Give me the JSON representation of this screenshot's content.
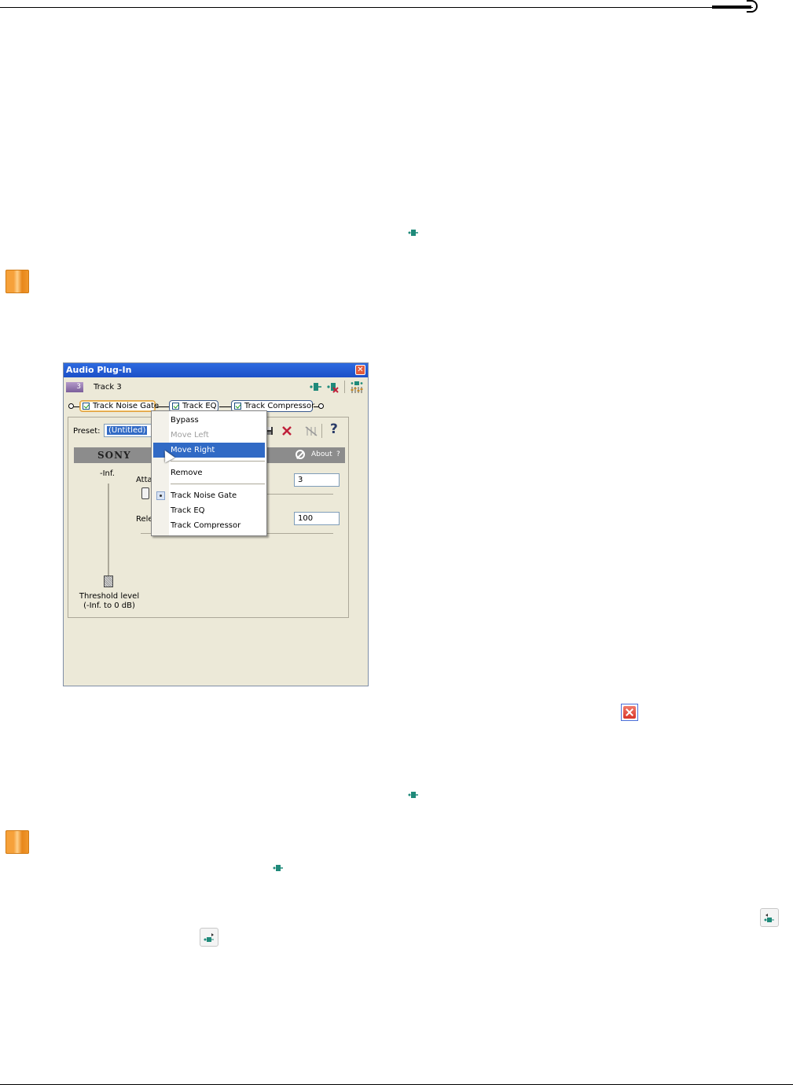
{
  "window": {
    "title": "Audio Plug-In",
    "close_glyph": "✕",
    "track_number": "3",
    "track_name": "Track 3",
    "chain": [
      "Track Noise Gate",
      "Track EQ",
      "Track Compressor"
    ],
    "preset_label": "Preset:",
    "preset_value": "(Untitled)",
    "brand": "SONY",
    "about_label": "About",
    "about_help": "?",
    "help_glyph": "?",
    "inf_label": "-Inf.",
    "attack_label_partial": "Atta",
    "release_label_partial": "Rele",
    "attack_value": "3",
    "release_value": "100",
    "threshold_label_line1": "Threshold level",
    "threshold_label_line2": "(-Inf. to 0 dB)"
  },
  "context_menu": {
    "items": [
      "Bypass",
      "Move Left",
      "Move Right",
      "Remove"
    ],
    "plugins": [
      "Track Noise Gate",
      "Track EQ",
      "Track Compressor"
    ],
    "highlighted": "Move Right",
    "disabled": [
      "Move Left"
    ],
    "checked_plugin": "Track Noise Gate"
  },
  "icons": {
    "note": "note-icon",
    "plugin_chain": "plugin-chain-icon",
    "close": "close-icon",
    "move_left": "move-plugin-left-icon",
    "move_right": "move-plugin-right-icon"
  },
  "colors": {
    "titlebar": "#1c50c8",
    "highlight": "#316ac5",
    "note": "#f19a2f"
  }
}
